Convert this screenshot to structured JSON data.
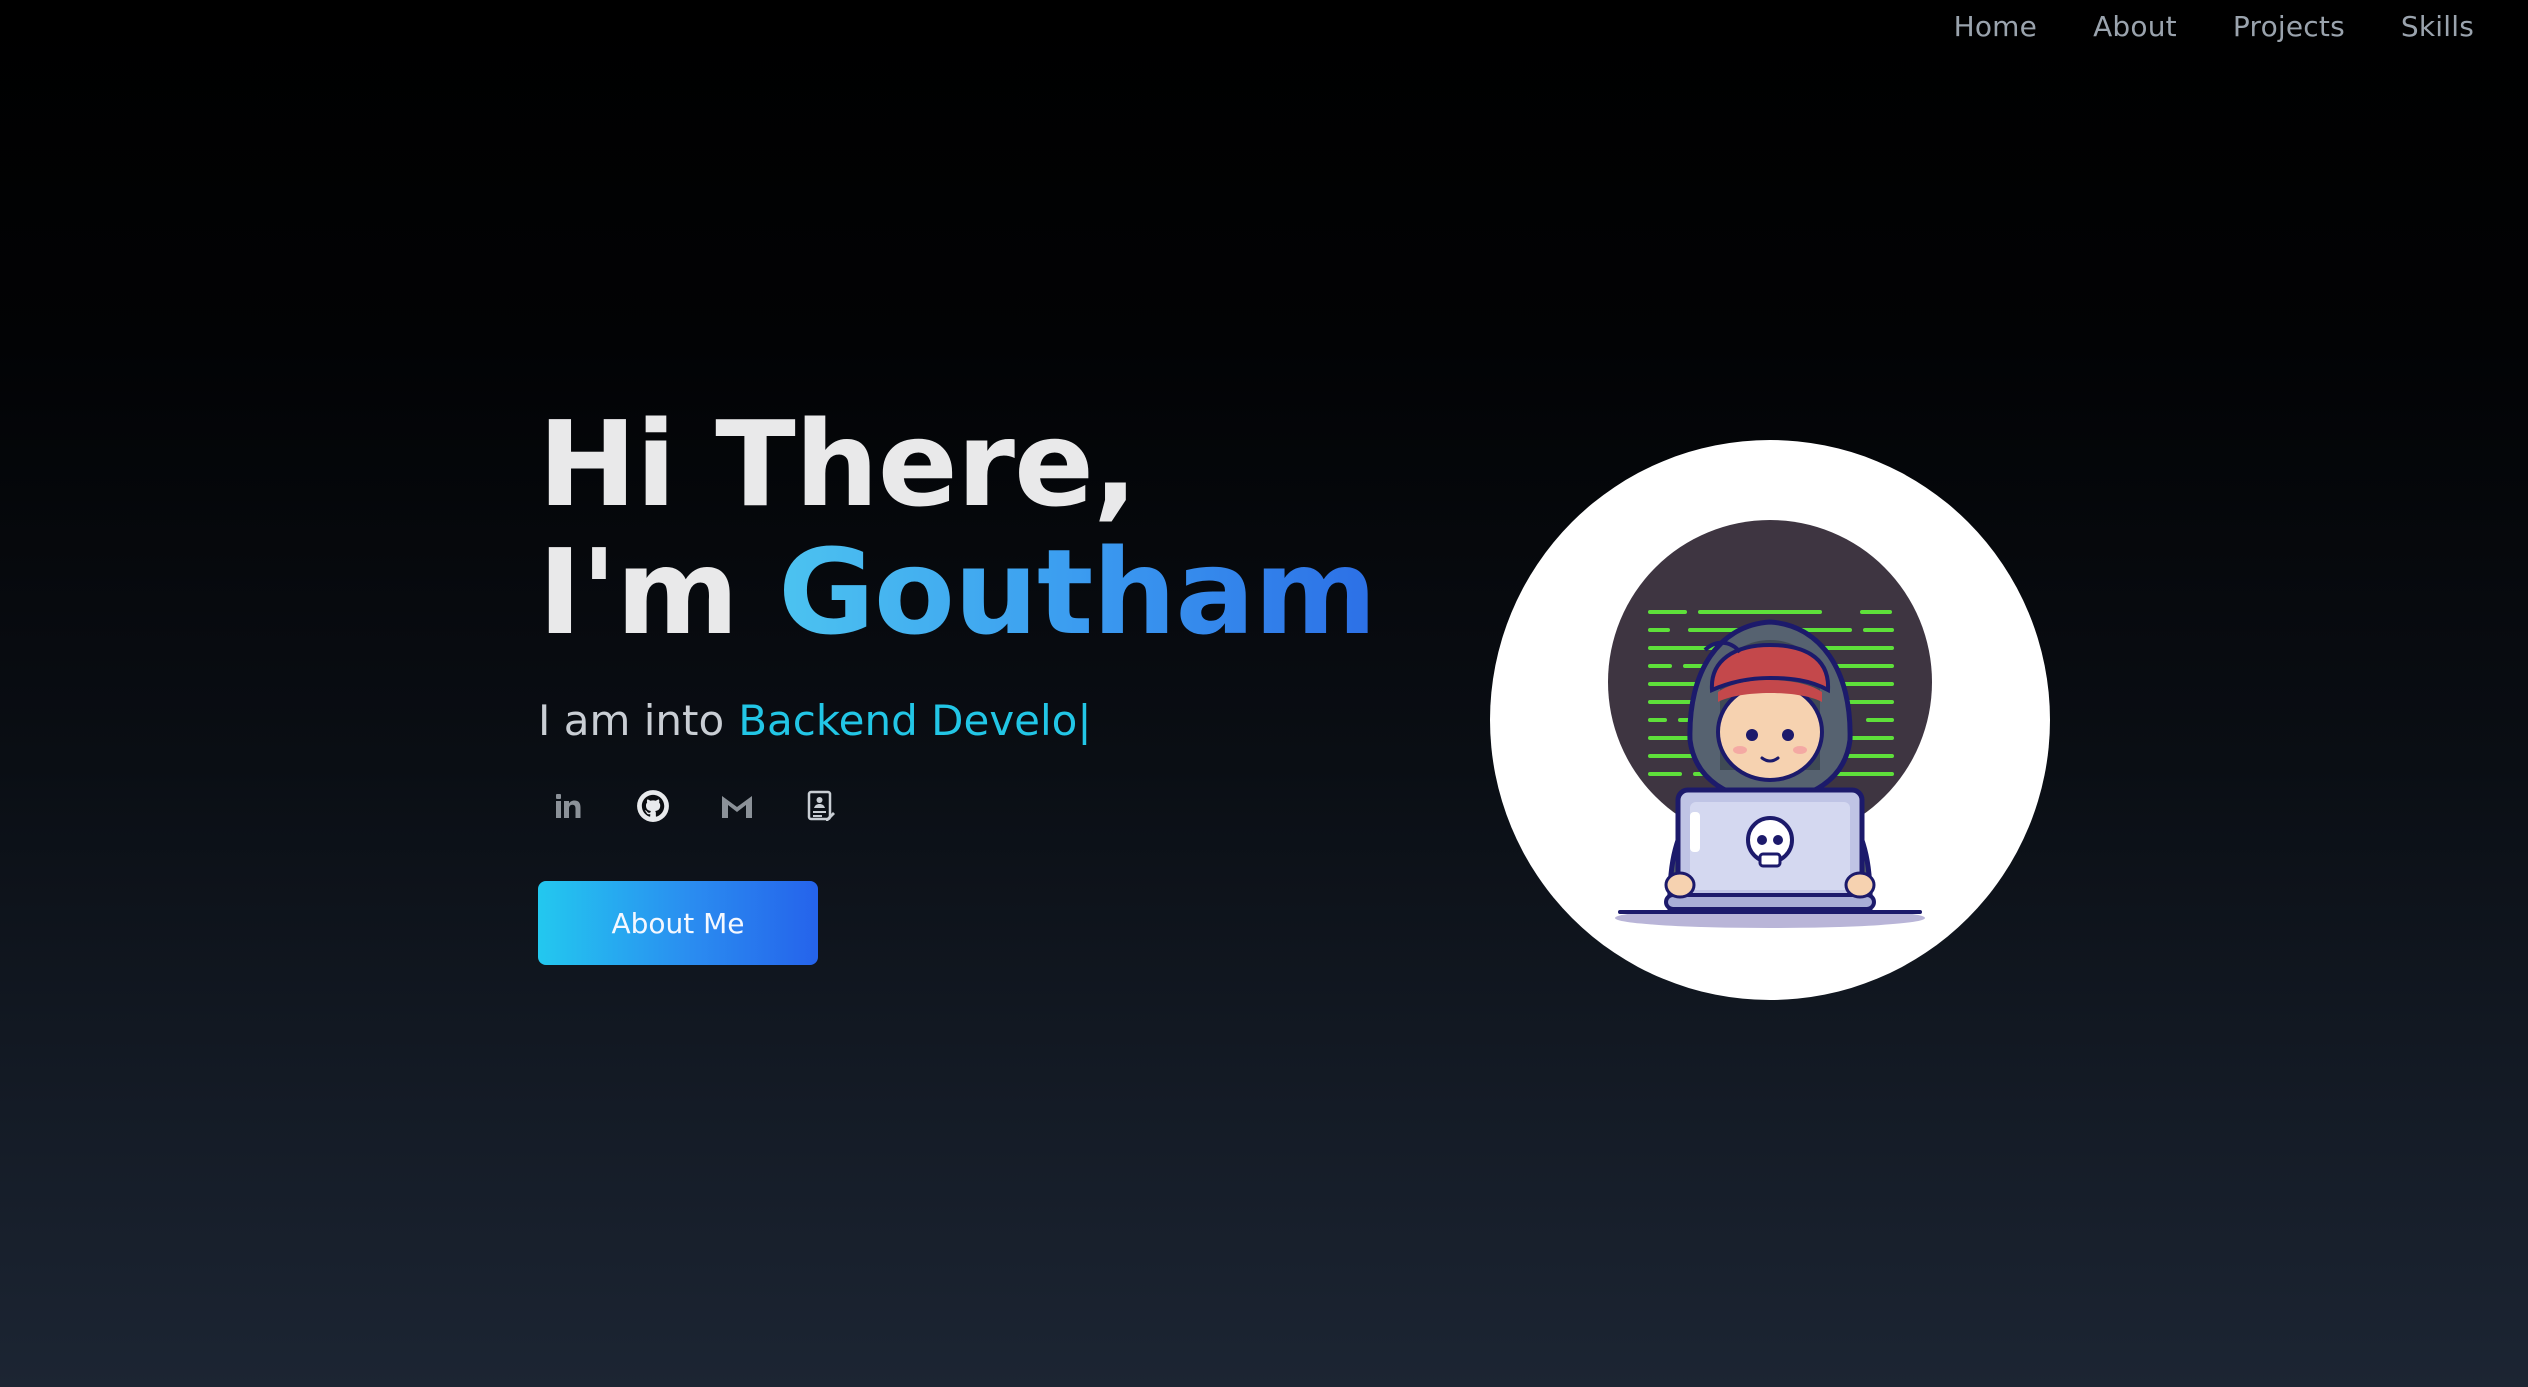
{
  "nav": {
    "items": [
      {
        "label": "Home"
      },
      {
        "label": "About"
      },
      {
        "label": "Projects"
      },
      {
        "label": "Skills"
      }
    ]
  },
  "hero": {
    "line1": "Hi There,",
    "line2_prefix": "I'm ",
    "name": "Goutham",
    "typing_prefix": "I am into",
    "typing_text": "Backend Develo",
    "typing_cursor": "|",
    "about_button": "About Me"
  },
  "socials": [
    {
      "icon": "linkedin-icon"
    },
    {
      "icon": "github-icon"
    },
    {
      "icon": "gmail-icon"
    },
    {
      "icon": "resume-icon"
    }
  ],
  "colors": {
    "accent_cyan": "#22c6e6",
    "accent_blue": "#2563eb",
    "heading": "#e9e9ea",
    "nav_text": "#9aa3ad"
  }
}
